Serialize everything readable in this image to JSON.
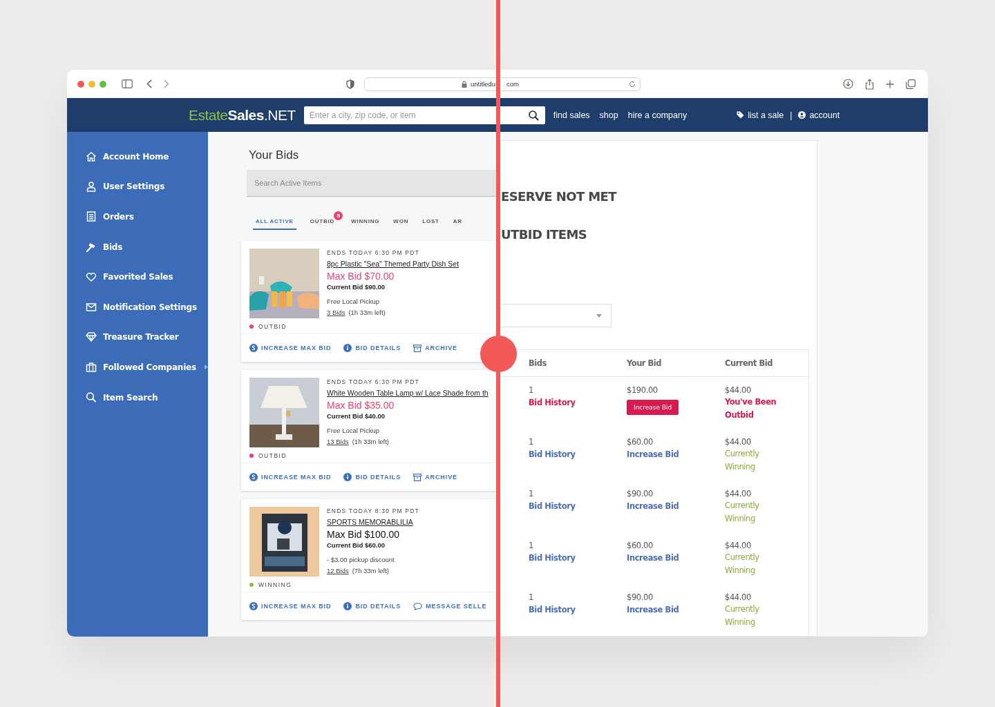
{
  "browser": {
    "url_start": "untitledu",
    "url_end": "com"
  },
  "navbar": {
    "logo": {
      "part_1": "Estate",
      "part_2": "Sales",
      "part_3": ".NET"
    },
    "search": {
      "placeholder": "Enter a city, zip code, or item"
    },
    "links": [
      "find sales",
      "shop",
      "hire a company"
    ],
    "list_a_sale": "list a sale",
    "separator": "|",
    "account": "account"
  },
  "sidebar": {
    "items": [
      {
        "kind": "home",
        "label": "Account Home",
        "has_submenu": false
      },
      {
        "kind": "user",
        "label": "User Settings",
        "has_submenu": false
      },
      {
        "kind": "orders",
        "label": "Orders",
        "has_submenu": false
      },
      {
        "kind": "gavel",
        "label": "Bids",
        "has_submenu": false
      },
      {
        "kind": "heart",
        "label": "Favorited Sales",
        "has_submenu": false
      },
      {
        "kind": "mail",
        "label": "Notification Settings",
        "has_submenu": false
      },
      {
        "kind": "diamond",
        "label": "Treasure Tracker",
        "has_submenu": false
      },
      {
        "kind": "briefcase",
        "label": "Followed Companies",
        "has_submenu": true
      },
      {
        "kind": "search",
        "label": "Item Search",
        "has_submenu": false
      }
    ]
  },
  "new_design": {
    "title": "Your Bids",
    "search": {
      "placeholder": "Search Active Items"
    },
    "tabs": [
      {
        "label": "ALL ACTIVE",
        "selected": true
      },
      {
        "label": "OUTBID",
        "selected": false,
        "badge": "5"
      },
      {
        "label": "WINNING",
        "selected": false
      },
      {
        "label": "WON",
        "selected": false
      },
      {
        "label": "LOST",
        "selected": false
      },
      {
        "label": "AR",
        "selected": false
      }
    ],
    "cards": [
      {
        "ends": "ENDS TODAY 6:30 PM PDT",
        "title": "8pc Plastic \"Sea\" Themed Party Dish Set",
        "max_bid": "Max Bid $70.00",
        "current_bid": "Current Bid $90.00",
        "pickup": "Free Local Pickup",
        "bids": "3 Bids",
        "time_left": "(1h 33m left)",
        "outbid": true,
        "status_label": "OUTBID",
        "actions": [
          {
            "kind": "increase",
            "label": "INCREASE MAX BID"
          },
          {
            "kind": "details",
            "label": "BID DETAILS"
          },
          {
            "kind": "archive",
            "label": "ARCHIVE"
          }
        ]
      },
      {
        "ends": "ENDS TODAY 6:30 PM PDT",
        "title": "White Wooden Table Lamp w/ Lace Shade from th",
        "max_bid": "Max Bid $35.00",
        "current_bid": "Current Bid $40.00",
        "pickup": "Free Local Pickup",
        "bids": "13 Bids",
        "time_left": "(1h 33m left)",
        "outbid": true,
        "status_label": "OUTBID",
        "actions": [
          {
            "kind": "increase",
            "label": "INCREASE MAX BID"
          },
          {
            "kind": "details",
            "label": "BID DETAILS"
          },
          {
            "kind": "archive",
            "label": "ARCHIVE"
          }
        ]
      },
      {
        "ends": "ENDS TODAY 8:30 PM PDT",
        "title": "SPORTS MEMORABLILIA",
        "max_bid": "Max Bid $100.00",
        "current_bid": "Current Bid $60.00",
        "pickup": "- $3.00  pickup discount",
        "bids": "12 Bids",
        "time_left": "(7h 33m left)",
        "outbid": false,
        "status_label": "WINNING",
        "actions": [
          {
            "kind": "increase",
            "label": "INCREASE MAX BID"
          },
          {
            "kind": "details",
            "label": "BID DETAILS"
          },
          {
            "kind": "message",
            "label": "MESSAGE SELLE"
          }
        ]
      }
    ]
  },
  "old_design": {
    "heading_1": "ESERVE NOT MET",
    "heading_2": "UTBID ITEMS",
    "table": {
      "columns": [
        "Bids",
        "Your Bid",
        "Current Bid"
      ],
      "rows": [
        {
          "bids": "1",
          "history": "Bid History",
          "your_bid": "$190.00",
          "action": "Increase Bid",
          "current_bid": "$44.00",
          "outbid": true,
          "status_text": "You've Been Outbid"
        },
        {
          "bids": "1",
          "history": "Bid History",
          "your_bid": "$60.00",
          "action": "Increase Bid",
          "current_bid": "$44.00",
          "outbid": false,
          "status_text": "Currently Winning"
        },
        {
          "bids": "1",
          "history": "Bid History",
          "your_bid": "$90.00",
          "action": "Increase Bid",
          "current_bid": "$44.00",
          "outbid": false,
          "status_text": "Currently Winning"
        },
        {
          "bids": "1",
          "history": "Bid History",
          "your_bid": "$60.00",
          "action": "Increase Bid",
          "current_bid": "$44.00",
          "outbid": false,
          "status_text": "Currently Winning"
        },
        {
          "bids": "1",
          "history": "Bid History",
          "your_bid": "$90.00",
          "action": "Increase Bid",
          "current_bid": "$44.00",
          "outbid": false,
          "status_text": "Currently Winning"
        }
      ]
    }
  }
}
